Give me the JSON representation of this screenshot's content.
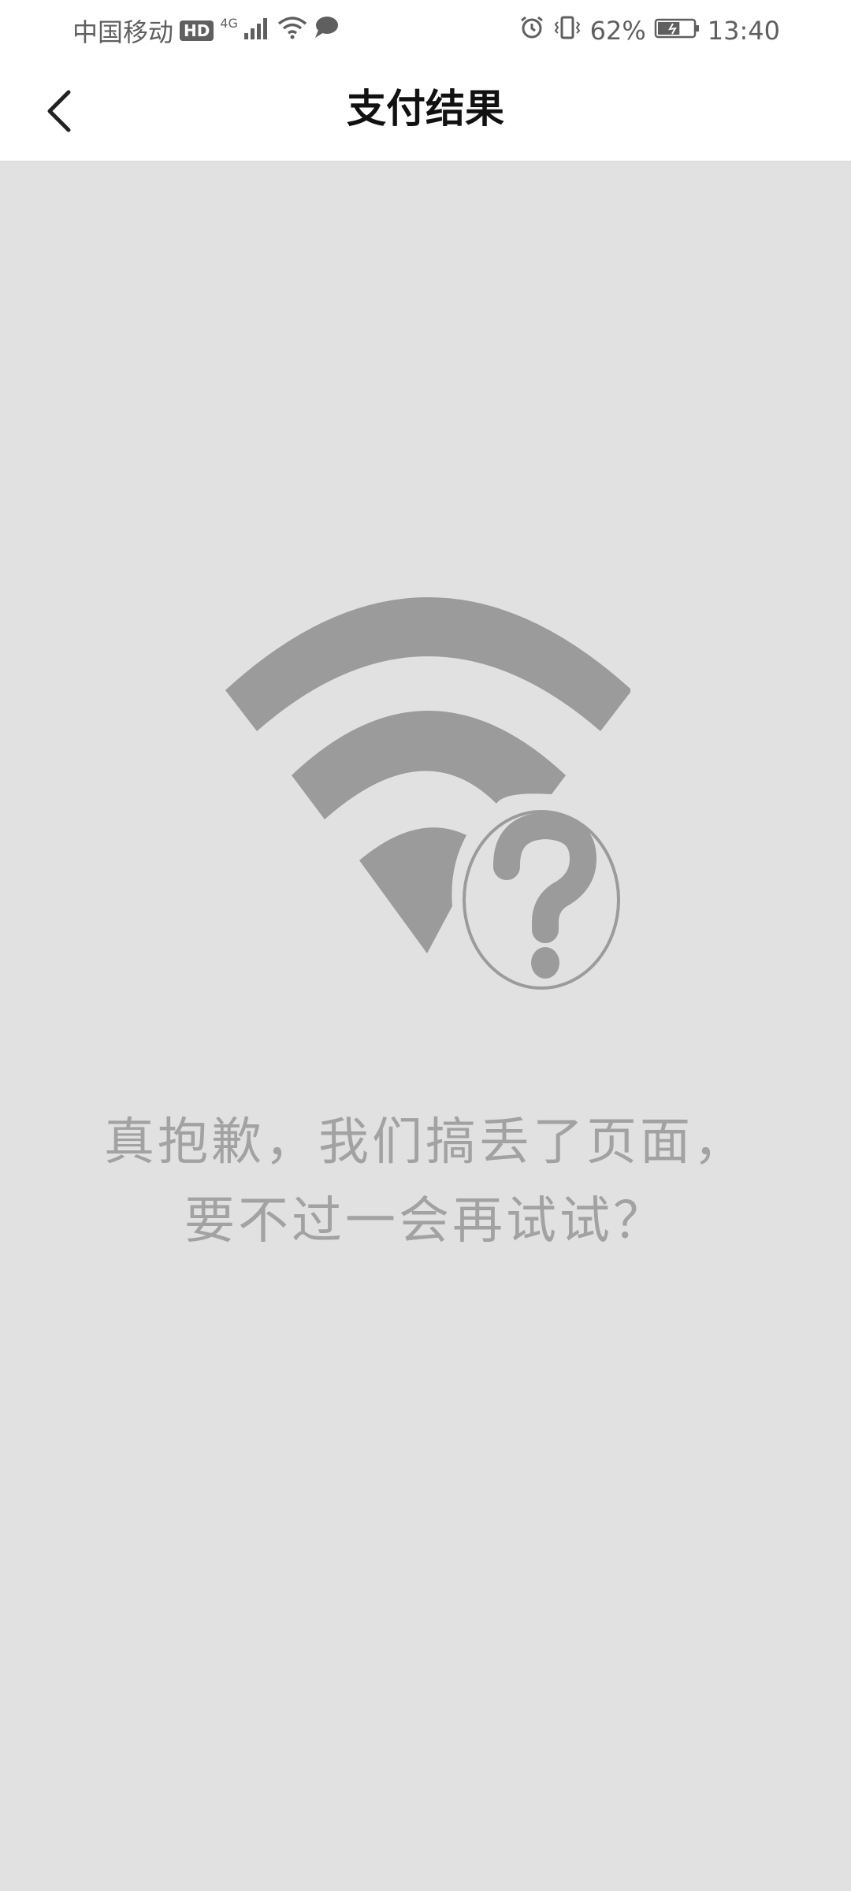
{
  "status_bar": {
    "carrier": "中国移动",
    "hd_badge": "HD",
    "network_type": "4G",
    "battery_percent": "62%",
    "time": "13:40",
    "battery_level": 0.62,
    "icons": [
      "signal-icon",
      "wifi-icon",
      "chat-icon",
      "alarm-icon",
      "vibrate-icon",
      "battery-icon"
    ]
  },
  "nav": {
    "title": "支付结果",
    "back_icon": "chevron-left-icon"
  },
  "error": {
    "illustration_icon": "wifi-question-icon",
    "line1": "真抱歉，我们搞丢了页面，",
    "line2": "要不过一会再试试？"
  },
  "colors": {
    "background": "#e1e1e1",
    "illustration": "#9b9b9b",
    "message_text": "#a2a2a2",
    "status_text": "#5f5f5f"
  }
}
